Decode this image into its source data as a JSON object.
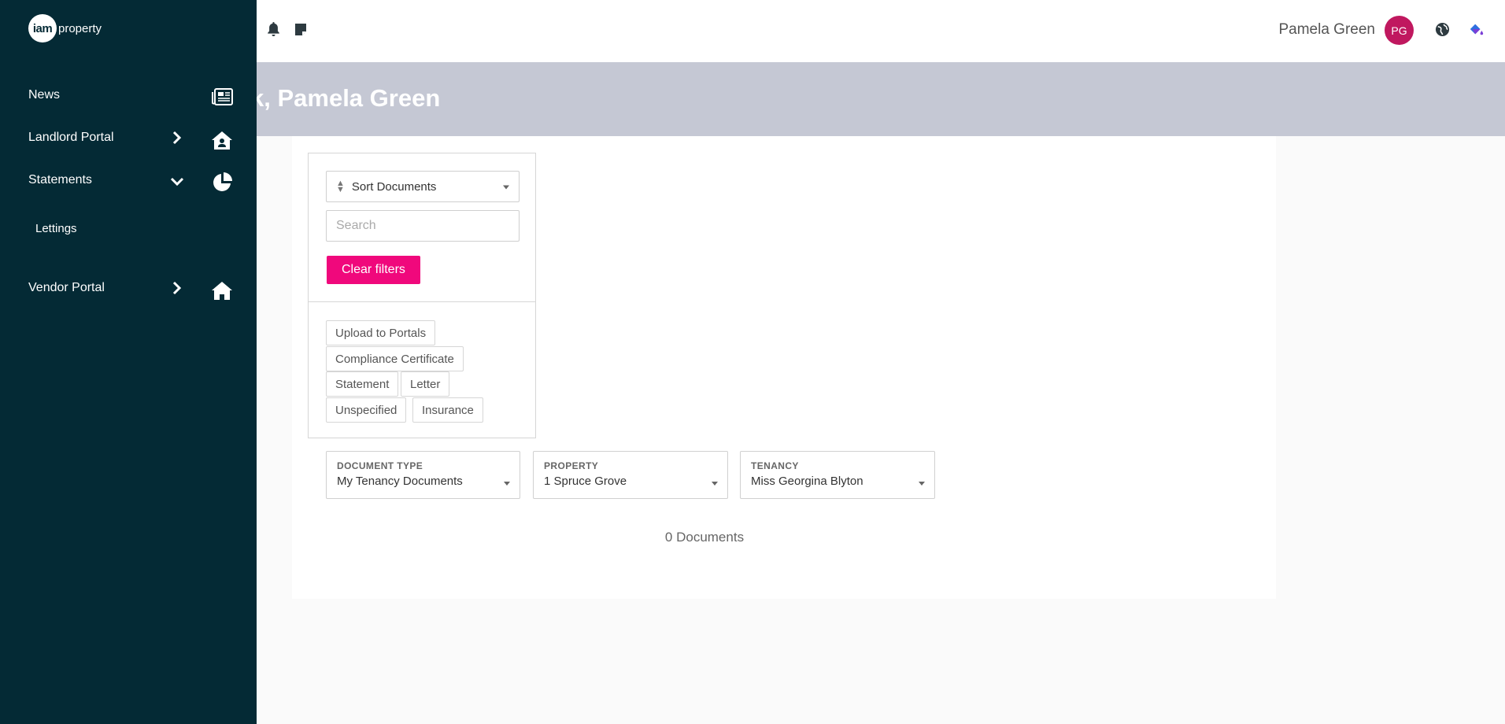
{
  "app": {
    "logo_mark": "iam",
    "logo_text": "property"
  },
  "header": {
    "user_name": "Pamela Green",
    "avatar_initials": "PG",
    "icons": [
      "bell-icon",
      "sticky-note-icon",
      "globe-icon",
      "paint-bucket-icon"
    ]
  },
  "banner": {
    "title": "k, Pamela Green"
  },
  "sidebar": {
    "items": [
      {
        "label": "News",
        "icon": "newspaper-icon"
      },
      {
        "label": "Landlord Portal",
        "icon": "house-user-icon",
        "chevron": "chevron-right"
      },
      {
        "label": "Statements",
        "icon": "pie-chart-icon",
        "chevron": "chevron-down"
      },
      {
        "label": "Vendor Portal",
        "icon": "home-icon",
        "chevron": "chevron-right"
      }
    ],
    "sub_items": [
      {
        "label": "Lettings"
      }
    ]
  },
  "filters": {
    "sort_label": "Sort Documents",
    "search_placeholder": "Search",
    "clear_label": "Clear filters",
    "tags": [
      "Upload to Portals",
      "Compliance Certificate",
      "Statement",
      "Letter",
      "Unspecified",
      "Insurance"
    ]
  },
  "dropdowns": [
    {
      "label": "DOCUMENT TYPE",
      "value": "My Tenancy Documents"
    },
    {
      "label": "PROPERTY",
      "value": "1 Spruce Grove"
    },
    {
      "label": "TENANCY",
      "value": "Miss Georgina Blyton"
    }
  ],
  "results": {
    "count_text": "0 Documents"
  },
  "colors": {
    "sidebar_bg": "#042a35",
    "banner_bg": "#c5c8d4",
    "accent": "#f0087c",
    "avatar_bg": "#c0185f"
  }
}
